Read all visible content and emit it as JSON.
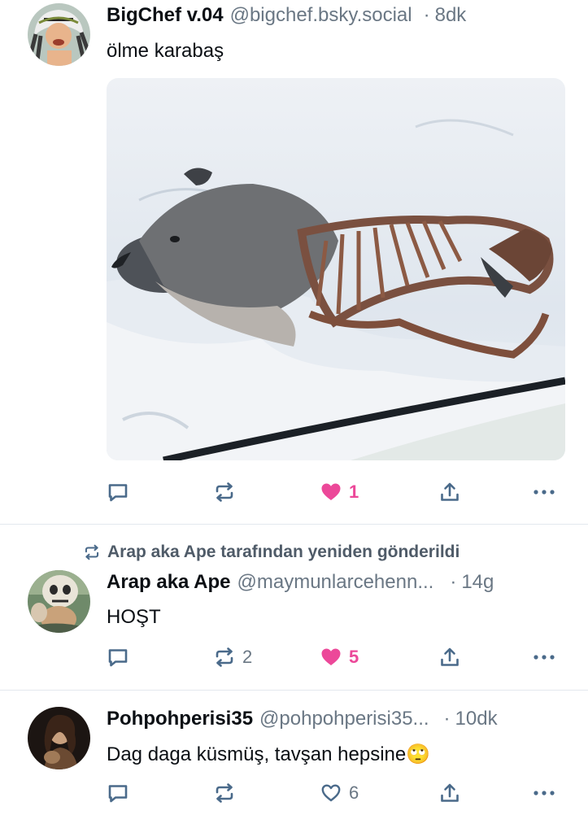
{
  "posts": [
    {
      "author_name": "BigChef v.04",
      "handle": "@bigchef.bsky.social",
      "separator": "·",
      "time": "8dk",
      "text": "ölme karabaş",
      "actions": {
        "reply_count": "",
        "repost_count": "",
        "like_count": "1",
        "liked": true
      }
    },
    {
      "reposted_by": "Arap aka Ape tarafından yeniden gönderildi",
      "author_name": "Arap aka Ape",
      "handle": "@maymunlarcehenn...",
      "separator": "·",
      "time": "14g",
      "text": "HOŞT",
      "actions": {
        "reply_count": "",
        "repost_count": "2",
        "like_count": "5",
        "liked": true
      }
    },
    {
      "author_name": "Pohpohperisi35",
      "handle": "@pohpohperisi35...",
      "separator": "·",
      "time": "10dk",
      "text": "Dag daga küsmüş, tavşan hepsine",
      "text_emoji": "🙄",
      "actions": {
        "reply_count": "",
        "repost_count": "",
        "like_count": "6",
        "liked": false
      }
    }
  ],
  "colors": {
    "like_active": "#ec4899",
    "icon": "#4a6a8a",
    "muted": "#6a7784",
    "divider": "#e3e8ee"
  },
  "icons": [
    "reply-icon",
    "repost-icon",
    "heart-icon",
    "share-icon",
    "more-icon"
  ]
}
